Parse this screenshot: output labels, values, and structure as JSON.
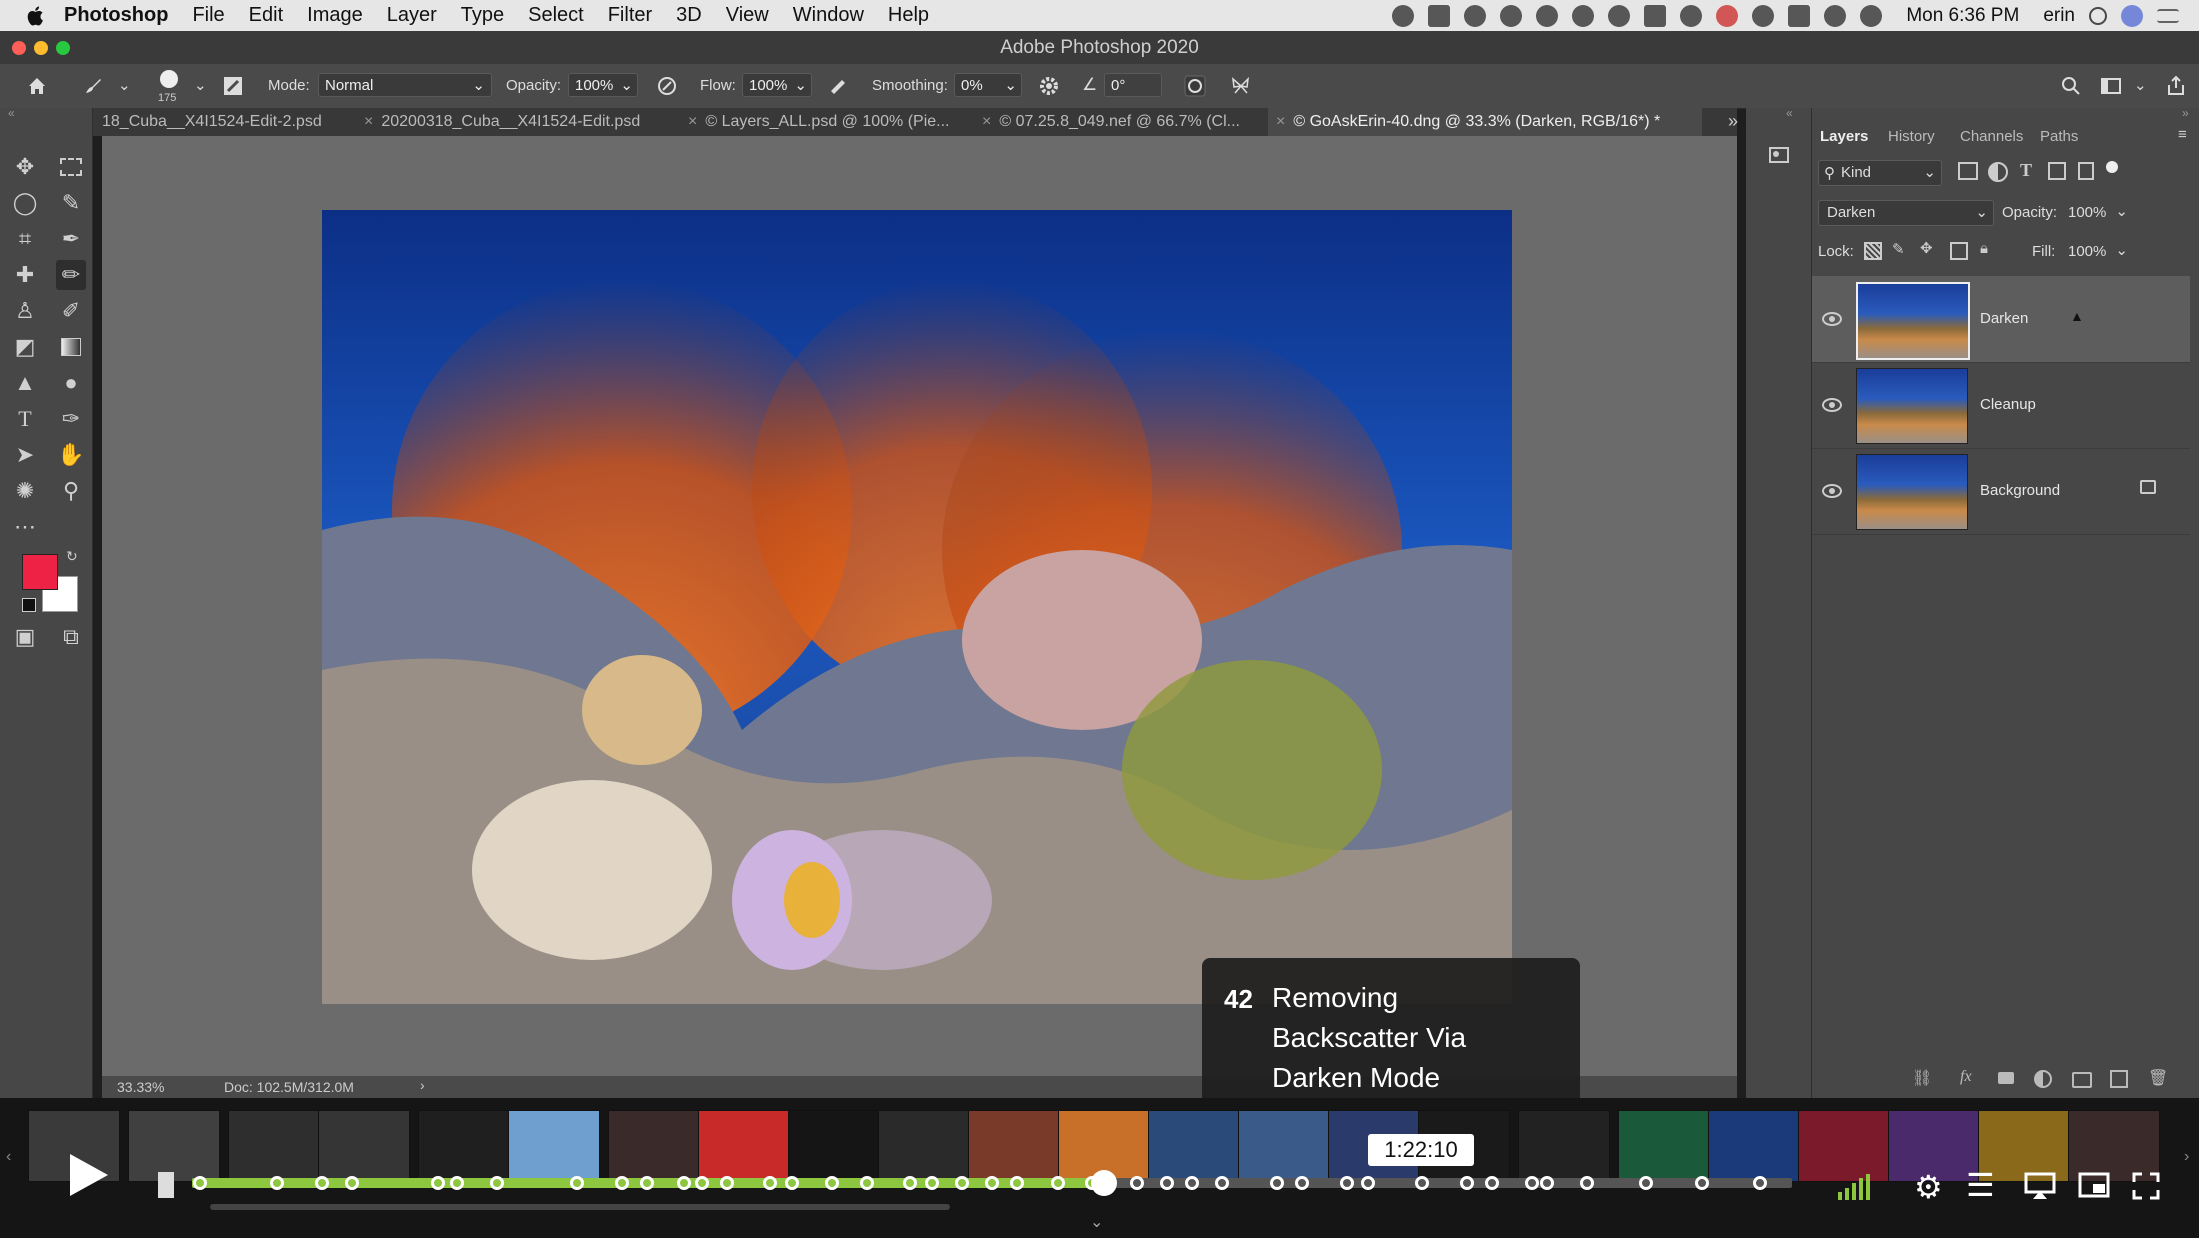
{
  "menubar": {
    "app_name": "Photoshop",
    "items": [
      "File",
      "Edit",
      "Image",
      "Layer",
      "Type",
      "Select",
      "Filter",
      "3D",
      "View",
      "Window",
      "Help"
    ],
    "clock": "Mon 6:36 PM",
    "user": "erin"
  },
  "window": {
    "title": "Adobe Photoshop 2020"
  },
  "options": {
    "brush_size": "175",
    "mode_label": "Mode:",
    "mode_value": "Normal",
    "opacity_label": "Opacity:",
    "opacity_value": "100%",
    "flow_label": "Flow:",
    "flow_value": "100%",
    "smoothing_label": "Smoothing:",
    "smoothing_value": "0%",
    "angle_value": "0°"
  },
  "tabs": [
    {
      "label": "18_Cuba__X4I1524-Edit-2.psd"
    },
    {
      "label": "20200318_Cuba__X4I1524-Edit.psd"
    },
    {
      "label": "© Layers_ALL.psd @ 100% (Pie..."
    },
    {
      "label": "© 07.25.8_049.nef @ 66.7% (Cl..."
    },
    {
      "label": "© GoAskErin-40.dng @ 33.3% (Darken, RGB/16*) *"
    }
  ],
  "status": {
    "zoom": "33.33%",
    "doc": "Doc: 102.5M/312.0M"
  },
  "layers_panel": {
    "tabs": [
      "Layers",
      "History",
      "Channels",
      "Paths"
    ],
    "kind_label": "Kind",
    "blend_mode": "Darken",
    "opacity_label": "Opacity:",
    "opacity_value": "100%",
    "lock_label": "Lock:",
    "fill_label": "Fill:",
    "fill_value": "100%",
    "layers": [
      {
        "name": "Darken",
        "selected": true
      },
      {
        "name": "Cleanup",
        "selected": false
      },
      {
        "name": "Background",
        "selected": false,
        "locked": true
      }
    ]
  },
  "overlay": {
    "number": "42",
    "line1": "Removing",
    "line2": "Backscatter Via",
    "line3": "Darken Mode"
  },
  "player": {
    "timestamp": "1:22:10",
    "progress_fraction": 0.57,
    "accent_color": "#8dc63f"
  }
}
